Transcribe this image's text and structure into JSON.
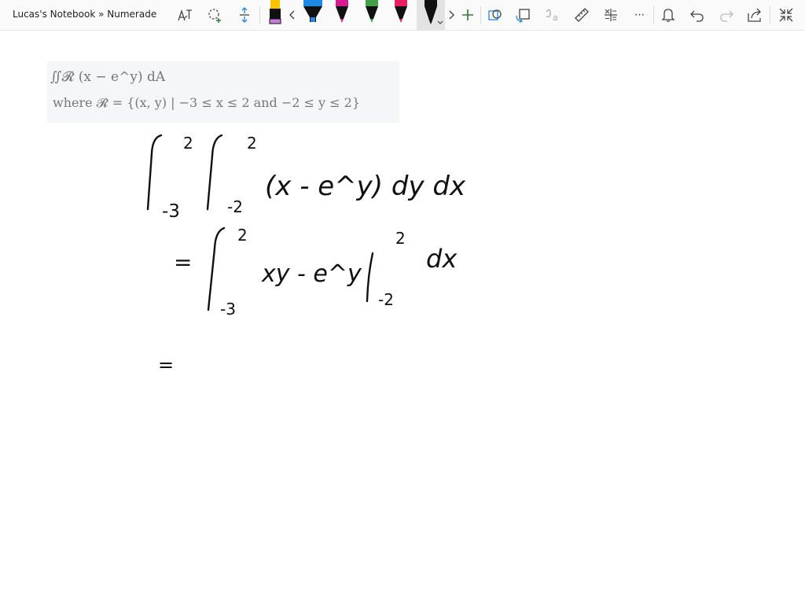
{
  "window": {
    "title": "Lucas's Notebook » Numerade"
  },
  "toolbar": {
    "icons": [
      "text-icon",
      "lasso-select-icon",
      "add-space-icon",
      "pen-black-purple",
      "chevron-left-icon",
      "pen-blue",
      "pen-magenta",
      "pen-green",
      "pen-pink",
      "pen-black-selected",
      "chevron-right-icon",
      "add-pen-icon",
      "shape-icon",
      "ink-to-shape-icon",
      "ink-to-text-icon",
      "ruler-icon",
      "ink-to-math-icon",
      "more-icon",
      "bell-icon",
      "undo-icon",
      "redo-icon",
      "share-icon",
      "collapse-icon"
    ],
    "more_label": "···",
    "pen_colors": {
      "black_purple": "#111111",
      "purple_tip": "#c77be0",
      "blue": "#1e88e5",
      "magenta": "#d81b8c",
      "green": "#43a047",
      "pink": "#e91e63",
      "black": "#111111"
    },
    "accent": "#2e7d32"
  },
  "problem": {
    "line1": "∬𝓡 (x − e^y) dA",
    "line2": "where 𝓡 = {(x, y) | −3 ≤ x ≤ 2 and −2 ≤ y ≤ 2}"
  },
  "ink": {
    "lower_outer": "-3",
    "upper_outer": "2",
    "lower_inner": "-2",
    "upper_inner": "2",
    "integrand": "(x - e^y) dy dx",
    "step2_eq": "=",
    "step2_lower": "-3",
    "step2_upper": "2",
    "step2_expr": "xy - e^y",
    "eval_upper": "2",
    "eval_lower": "-2",
    "step2_dx": "dx",
    "step3_eq": "="
  }
}
